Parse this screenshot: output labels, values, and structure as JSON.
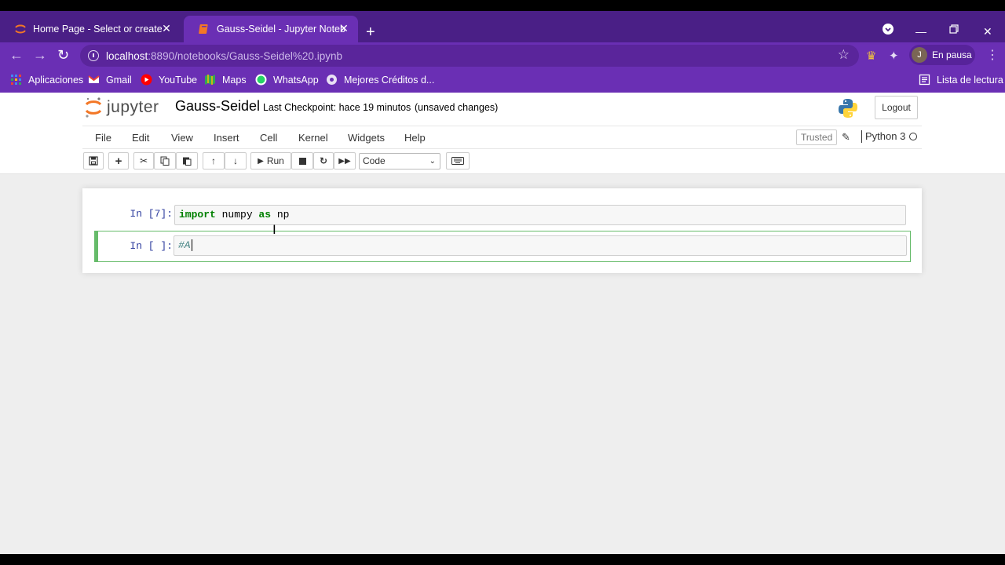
{
  "browser": {
    "tabs": [
      {
        "title": "Home Page - Select or create a n",
        "active": false
      },
      {
        "title": "Gauss-Seidel - Jupyter Notebook",
        "active": true
      }
    ],
    "url_host": "localhost",
    "url_path": ":8890/notebooks/Gauss-Seidel%20.ipynb",
    "profile_initial": "J",
    "profile_status": "En pausa",
    "bookmarks": [
      {
        "label": "Aplicaciones",
        "icon": "apps-grid-icon"
      },
      {
        "label": "Gmail",
        "icon": "gmail-icon"
      },
      {
        "label": "YouTube",
        "icon": "youtube-icon"
      },
      {
        "label": "Maps",
        "icon": "maps-icon"
      },
      {
        "label": "WhatsApp",
        "icon": "whatsapp-icon"
      },
      {
        "label": "Mejores Créditos d...",
        "icon": "globe-icon"
      }
    ],
    "reading_list": "Lista de lectura",
    "accent_color": "#6a2fb4",
    "tabbar_color": "#4a1f86"
  },
  "jupyter": {
    "logo_text": "jupyter",
    "notebook_name": "Gauss-Seidel",
    "checkpoint": "Last Checkpoint: hace 19 minutos",
    "unsaved": "(unsaved changes)",
    "logout": "Logout",
    "menu": [
      "File",
      "Edit",
      "View",
      "Insert",
      "Cell",
      "Kernel",
      "Widgets",
      "Help"
    ],
    "trusted": "Trusted",
    "kernel": "Python 3",
    "run_label": "Run",
    "cell_type": "Code",
    "cells": [
      {
        "prompt": "In [7]:",
        "code_kw": "import",
        "code_mid": " numpy ",
        "code_kw2": "as",
        "code_end": " np"
      },
      {
        "prompt": "In [ ]:",
        "code": "#A"
      }
    ]
  }
}
